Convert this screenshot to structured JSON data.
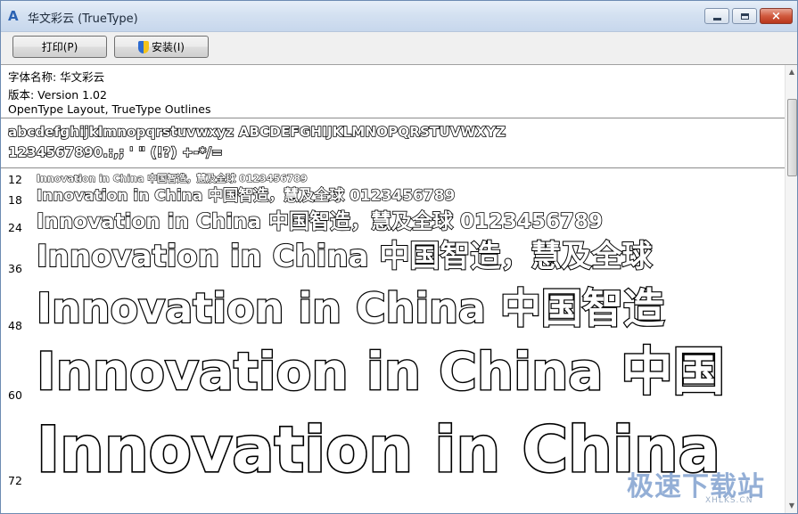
{
  "window": {
    "title": "华文彩云 (TrueType)",
    "app_icon": "font-viewer-icon",
    "controls": {
      "minimize": "minimize-icon",
      "maximize": "maximize-icon",
      "close": "×"
    }
  },
  "toolbar": {
    "print_label": "打印(P)",
    "install_label": "安装(I)",
    "install_icon": "uac-shield-icon"
  },
  "font_info": {
    "name_line": "字体名称: 华文彩云",
    "version_line": "版本: Version 1.02",
    "type_line": "OpenType Layout, TrueType Outlines"
  },
  "charset": {
    "line1": "abcdefghijklmnopqrstuvwxyz ABCDEFGHIJKLMNOPQRSTUVWXYZ",
    "line2": "1234567890.:,; ' \" (!?) +-*/="
  },
  "samples": [
    {
      "size": "12",
      "text": "Innovation in China 中国智造，慧及全球 0123456789"
    },
    {
      "size": "18",
      "text": "Innovation in China 中国智造，慧及全球 0123456789"
    },
    {
      "size": "24",
      "text": "Innovation in China 中国智造，慧及全球 0123456789"
    },
    {
      "size": "36",
      "text": "Innovation in China 中国智造，慧及全球"
    },
    {
      "size": "48",
      "text": "Innovation in China 中国智造"
    },
    {
      "size": "60",
      "text": "Innovation in China 中国"
    },
    {
      "size": "72",
      "text": "Innovation in China"
    }
  ],
  "watermark": {
    "main": "极速下载站",
    "sub": "XHLKS.CN"
  }
}
